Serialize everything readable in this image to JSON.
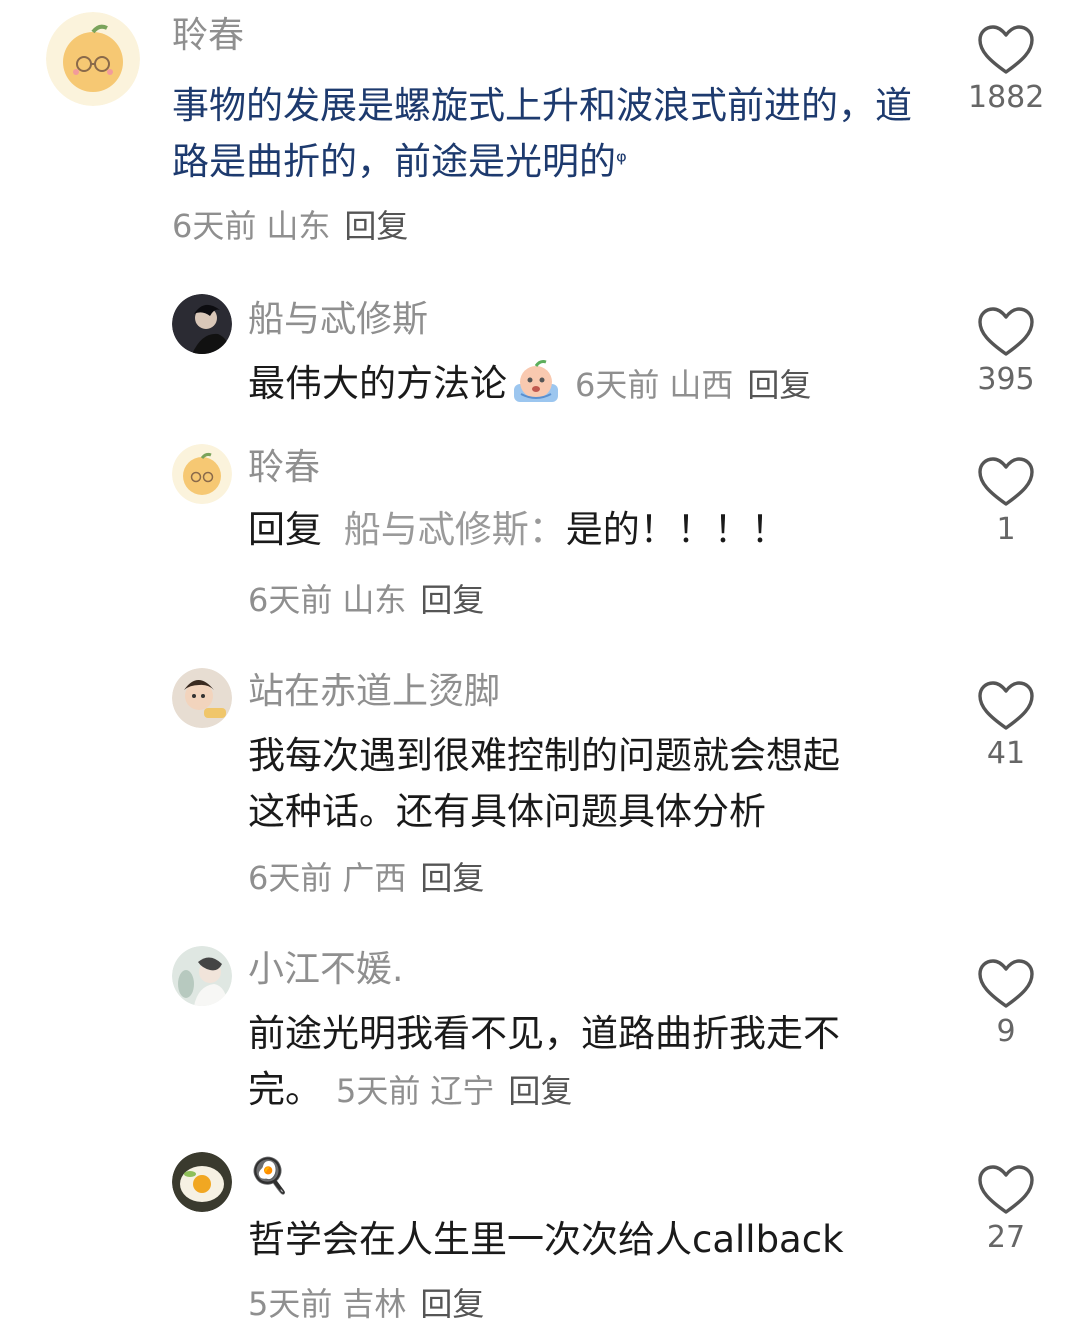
{
  "comments": [
    {
      "user": "聆春",
      "text": "事物的发展是螺旋式上升和波浪式前进的，道路是曲折的，前途是光明的",
      "search_glyph": "ᵠ",
      "time": "6天前",
      "location": "山东",
      "reply_label": "回复",
      "likes": "1882"
    },
    {
      "user": "船与忒修斯",
      "text": "最伟大的方法论",
      "emoji": "crying-peach-emoji",
      "time": "6天前",
      "location": "山西",
      "reply_label": "回复",
      "likes": "395"
    },
    {
      "user": "聆春",
      "reply_prefix": "回复",
      "reply_to": "船与忒修斯：",
      "text": "是的！！！！",
      "time": "6天前",
      "location": "山东",
      "reply_label": "回复",
      "likes": "1"
    },
    {
      "user": "站在赤道上烫脚",
      "text_line1": "我每次遇到很难控制的问题就会想起",
      "text_line2": "这种话。还有具体问题具体分析",
      "time": "6天前",
      "location": "广西",
      "reply_label": "回复",
      "likes": "41"
    },
    {
      "user": "小江不媛.",
      "text_line1": "前途光明我看不见，道路曲折我走不",
      "text_line2": "完。",
      "time": "5天前",
      "location": "辽宁",
      "reply_label": "回复",
      "likes": "9"
    },
    {
      "user": "🍳",
      "text": "哲学会在人生里一次次给人callback",
      "time": "5天前",
      "location": "吉林",
      "reply_label": "回复",
      "likes": "27"
    }
  ],
  "colors": {
    "accent_link": "#1d3a6e",
    "meta_gray": "#8f8f8f",
    "heart_stroke": "#555555"
  }
}
